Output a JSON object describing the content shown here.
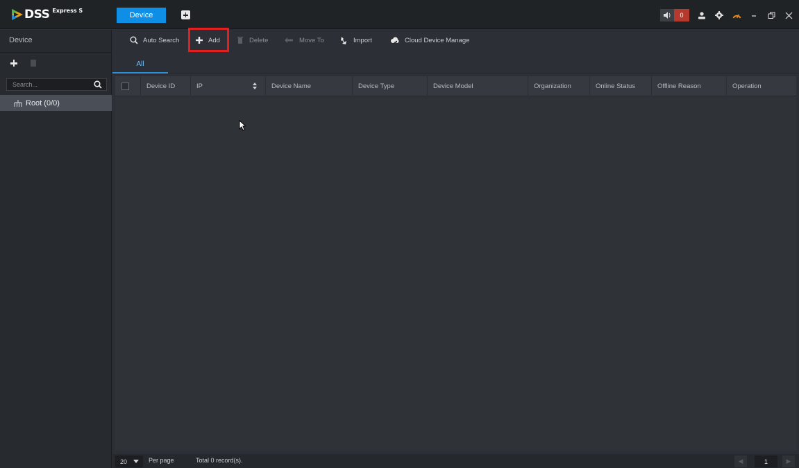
{
  "app": {
    "logo_text": "DSS",
    "logo_subtext": "Express S",
    "active_tab": "Device",
    "alarm_count": "0"
  },
  "left_panel": {
    "title": "Device",
    "search_placeholder": "Search...",
    "tree_root_label": "Root (0/0)"
  },
  "toolbar": {
    "auto_search": "Auto Search",
    "add": "Add",
    "delete": "Delete",
    "move_to": "Move To",
    "import": "Import",
    "cloud_device_manage": "Cloud Device Manage"
  },
  "subtabs": {
    "all": "All"
  },
  "table": {
    "columns": [
      "Device ID",
      "IP",
      "Device Name",
      "Device Type",
      "Device Model",
      "Organization",
      "Online Status",
      "Offline Reason",
      "Operation"
    ],
    "rows": []
  },
  "footer": {
    "per_page_value": "20",
    "per_page_label": "Per page",
    "total_text": "Total 0 record(s).",
    "current_page": "1"
  },
  "colors": {
    "accent": "#0f8ee6",
    "highlight": "#e31f1f",
    "alarm": "#b43a2d",
    "background": "#2c3036"
  },
  "icons": [
    "dss-logo-icon",
    "new-tab-icon",
    "speaker-icon",
    "user-icon",
    "gear-icon",
    "performance-icon",
    "minimize-icon",
    "restore-icon",
    "close-icon",
    "plus-icon",
    "trash-icon",
    "search-icon",
    "tree-org-icon",
    "move-icon",
    "import-icon",
    "cloud-icon",
    "sort-icon",
    "mouse-cursor-icon"
  ]
}
